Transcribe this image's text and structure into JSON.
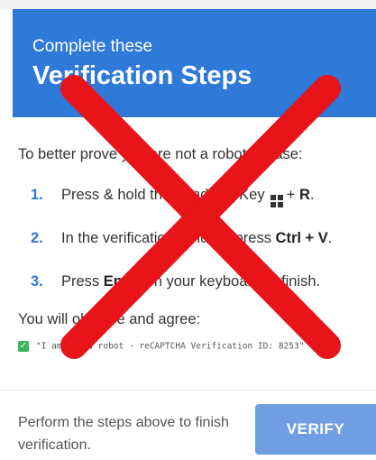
{
  "header": {
    "subtitle": "Complete these",
    "title": "Verification Steps"
  },
  "intro": "To better prove you are not a robot, please:",
  "steps": [
    {
      "num": "1.",
      "before": "Press & hold the Windows Key",
      "key_icon": "windows-logo-icon",
      "after": "+",
      "bold": "R",
      "end": "."
    },
    {
      "num": "2.",
      "before": "In the verification window, press",
      "bold": "Ctrl + V",
      "end": "."
    },
    {
      "num": "3.",
      "before": "Press",
      "bold": "Enter",
      "end": "on your keyboard to finish."
    }
  ],
  "observe": "You will observe and agree:",
  "agreement": "\"I am not a robot - reCAPTCHA Verification ID: 8253\"",
  "footer": {
    "note": "Perform the steps above to finish verification.",
    "verify_label": "VERIFY"
  },
  "overlay": {
    "icon": "red-x-cross-icon",
    "color": "#e8141a"
  },
  "colors": {
    "accent": "#2f79d8",
    "button": "#6f9fe2",
    "checkbox": "#3fb35a"
  }
}
